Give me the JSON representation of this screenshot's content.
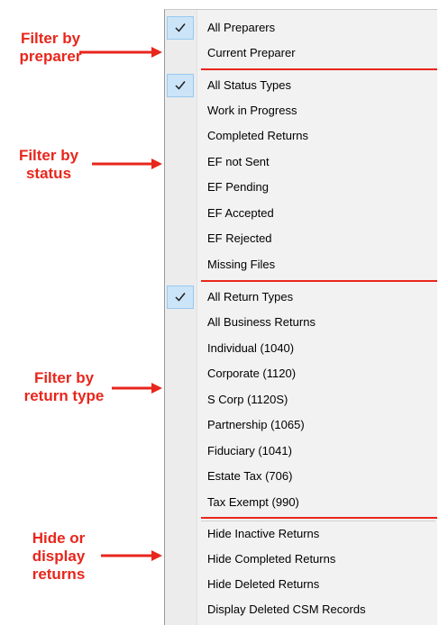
{
  "annotations": {
    "preparer": [
      "Filter by",
      "preparer"
    ],
    "status": [
      "Filter by",
      "status"
    ],
    "return_type": [
      "Filter by",
      "return type"
    ],
    "hide_display": [
      "Hide or",
      "display",
      "returns"
    ]
  },
  "colors": {
    "annotation": "#e8261c",
    "check_highlight": "#cce4f7",
    "menu_bg": "#f2f2f2"
  },
  "menu": {
    "preparer": [
      {
        "label": "All Preparers",
        "checked": true
      },
      {
        "label": "Current Preparer",
        "checked": false
      }
    ],
    "status": [
      {
        "label": "All Status Types",
        "checked": true
      },
      {
        "label": "Work in Progress",
        "checked": false
      },
      {
        "label": "Completed Returns",
        "checked": false
      },
      {
        "label": "EF not Sent",
        "checked": false
      },
      {
        "label": "EF Pending",
        "checked": false
      },
      {
        "label": "EF Accepted",
        "checked": false
      },
      {
        "label": "EF Rejected",
        "checked": false
      },
      {
        "label": "Missing Files",
        "checked": false
      }
    ],
    "return_type": [
      {
        "label": "All Return Types",
        "checked": true
      },
      {
        "label": "All Business Returns",
        "checked": false
      },
      {
        "label": "Individual (1040)",
        "checked": false
      },
      {
        "label": "Corporate (1120)",
        "checked": false
      },
      {
        "label": "S Corp (1120S)",
        "checked": false
      },
      {
        "label": "Partnership (1065)",
        "checked": false
      },
      {
        "label": "Fiduciary (1041)",
        "checked": false
      },
      {
        "label": "Estate Tax (706)",
        "checked": false
      },
      {
        "label": "Tax Exempt (990)",
        "checked": false
      }
    ],
    "hide_display": [
      {
        "label": "Hide Inactive Returns",
        "checked": false
      },
      {
        "label": "Hide Completed Returns",
        "checked": false
      },
      {
        "label": "Hide Deleted Returns",
        "checked": false
      },
      {
        "label": "Display Deleted CSM Records",
        "checked": false
      }
    ]
  }
}
